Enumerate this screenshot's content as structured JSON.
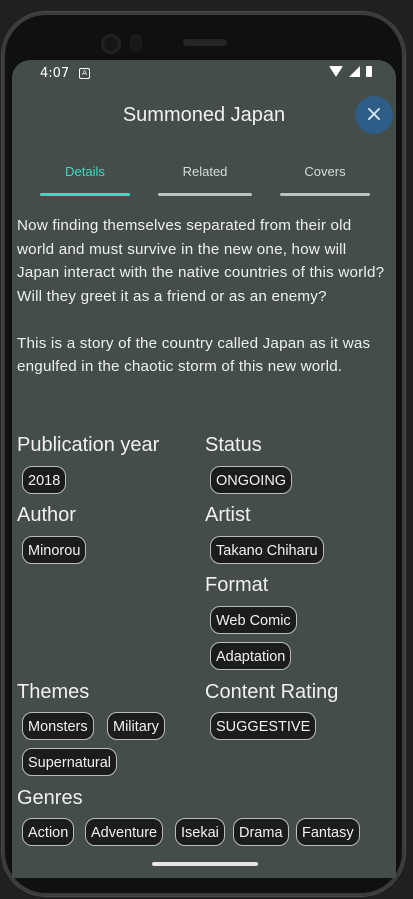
{
  "status_bar": {
    "time": "4:07",
    "notification_icon": "A"
  },
  "header": {
    "title": "Summoned Japan",
    "close_icon": "×"
  },
  "tabs": [
    {
      "label": "Details",
      "active": true
    },
    {
      "label": "Related",
      "active": false
    },
    {
      "label": "Covers",
      "active": false
    }
  ],
  "description": {
    "p1": "Now finding themselves separated from their old world and must survive in the new one, how will Japan interact with the native countries of this world? Will they greet it as a friend or as an enemy?",
    "p2": "This is a story of the country called Japan as it was engulfed in the chaotic storm of this new world."
  },
  "publication_year": {
    "label": "Publication year",
    "value": "2018"
  },
  "status": {
    "label": "Status",
    "value": "ONGOING"
  },
  "author": {
    "label": "Author",
    "value": "Minorou"
  },
  "artist": {
    "label": "Artist",
    "value": "Takano Chiharu"
  },
  "format": {
    "label": "Format",
    "values": [
      "Web Comic",
      "Adaptation"
    ]
  },
  "themes": {
    "label": "Themes",
    "values": [
      "Monsters",
      "Military",
      "Supernatural"
    ]
  },
  "content_rating": {
    "label": "Content Rating",
    "value": "SUGGESTIVE"
  },
  "genres": {
    "label": "Genres",
    "values": [
      "Action",
      "Adventure",
      "Isekai",
      "Drama",
      "Fantasy"
    ]
  },
  "colors": {
    "accent": "#3fd9c2",
    "background": "#444d4a",
    "close_button": "#2e5d88"
  }
}
